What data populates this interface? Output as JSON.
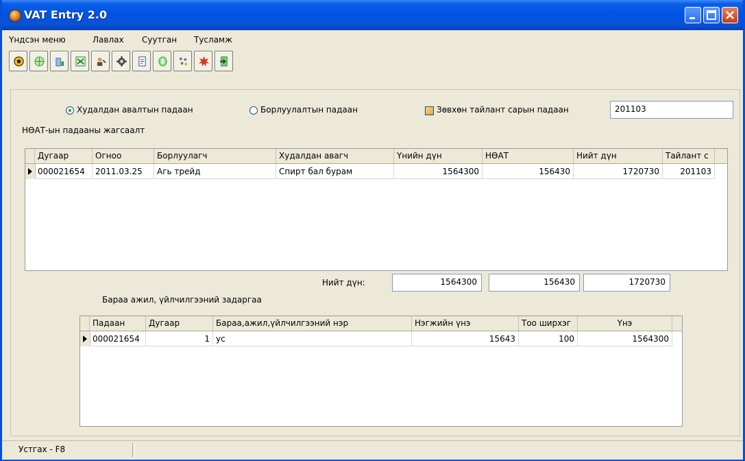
{
  "window": {
    "title": "VAT Entry 2.0"
  },
  "menu": [
    "Үндсэн меню",
    "Лавлах",
    "Суутган",
    "Тусламж"
  ],
  "toolbar": [
    {
      "icon": "flower-yellow-icon",
      "color": "#e0b400"
    },
    {
      "icon": "globe-icon",
      "color": "#2f9a3a"
    },
    {
      "icon": "building-icon",
      "color": "#3a6bc9"
    },
    {
      "icon": "spreadsheet-icon",
      "color": "#1b8a2a"
    },
    {
      "icon": "user-edit-icon",
      "color": "#6b4a2a"
    },
    {
      "icon": "gear-icon",
      "color": "#444444"
    },
    {
      "icon": "document-icon",
      "color": "#2a4a8a"
    },
    {
      "icon": "shield-icon",
      "color": "#2fa22f"
    },
    {
      "icon": "sparkle-icon",
      "color": "#c43a8a"
    },
    {
      "icon": "star-burst-icon",
      "color": "#d43a2a"
    },
    {
      "icon": "exit-door-icon",
      "color": "#1f7a3a"
    }
  ],
  "filters": {
    "radio_purchase": "Худалдан авалтын падаан",
    "radio_sales": "Борлуулалтын падаан",
    "checkbox_period": "Зөвхөн тайлант сарын падаан",
    "period_value": "201103"
  },
  "invoices": {
    "section_title": "НӨАТ-ын падааны жагсаалт",
    "columns": [
      "Дугаар",
      "Огноо",
      "Борлуулагч",
      "Худалдан авагч",
      "Үнийн дүн",
      "НӨАТ",
      "Нийт дүн",
      "Тайлант с"
    ],
    "rows": [
      [
        "000021654",
        "2011.03.25",
        "Агь трейд",
        "Спирт бал бурам",
        "1564300",
        "156430",
        "1720730",
        "201103"
      ]
    ],
    "total_label": "Нийт дүн:",
    "totals": [
      "1564300",
      "156430",
      "1720730"
    ]
  },
  "details": {
    "section_title": "Бараа ажил, үйлчилгээний задаргаа",
    "columns": [
      "Падаан",
      "Дугаар",
      "Бараа,ажил,үйлчилгээний нэр",
      "Нэгжийн үнэ",
      "Тоо ширхэг",
      "Үнэ"
    ],
    "rows": [
      [
        "000021654",
        "1",
        "ус",
        "15643",
        "100",
        "1564300"
      ]
    ]
  },
  "status": {
    "hint": "Устгах - F8"
  }
}
